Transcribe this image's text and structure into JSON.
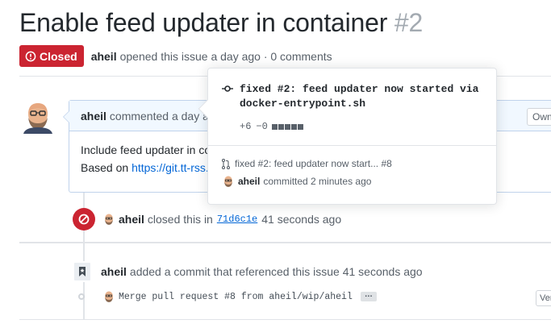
{
  "issue": {
    "title": "Enable feed updater in container",
    "number": "#2",
    "state": "Closed",
    "author": "aheil",
    "opened_text": "opened this issue a day ago · 0 comments"
  },
  "comment": {
    "author": "aheil",
    "header_text": "commented a day ago",
    "owner_badge": "Owner",
    "body_line1": "Include feed updater in container",
    "body_line2_prefix": "Based on",
    "body_link": "https://git.tt-rss.org"
  },
  "closed_event": {
    "author": "aheil",
    "text_before": "closed this in",
    "sha": "71d6c1e",
    "time": "41 seconds ago"
  },
  "commit_event": {
    "author": "aheil",
    "text": "added a commit that referenced this issue 41 seconds ago",
    "commit_message": "Merge pull request #8 from aheil/wip/aheil",
    "ellipsis": "…",
    "verified_badge": "Verified"
  },
  "hovercard": {
    "title": "fixed #2: feed updater now started via docker-entrypoint.sh",
    "additions": "+6",
    "deletions": "−0",
    "pr_text": "fixed #2: feed updater now start... #8",
    "committer": "aheil",
    "committed_text": "committed 2 minutes ago"
  },
  "colors": {
    "closed_red": "#cb2431",
    "link_blue": "#0366d6",
    "comment_header_bg": "#f1f8ff"
  }
}
